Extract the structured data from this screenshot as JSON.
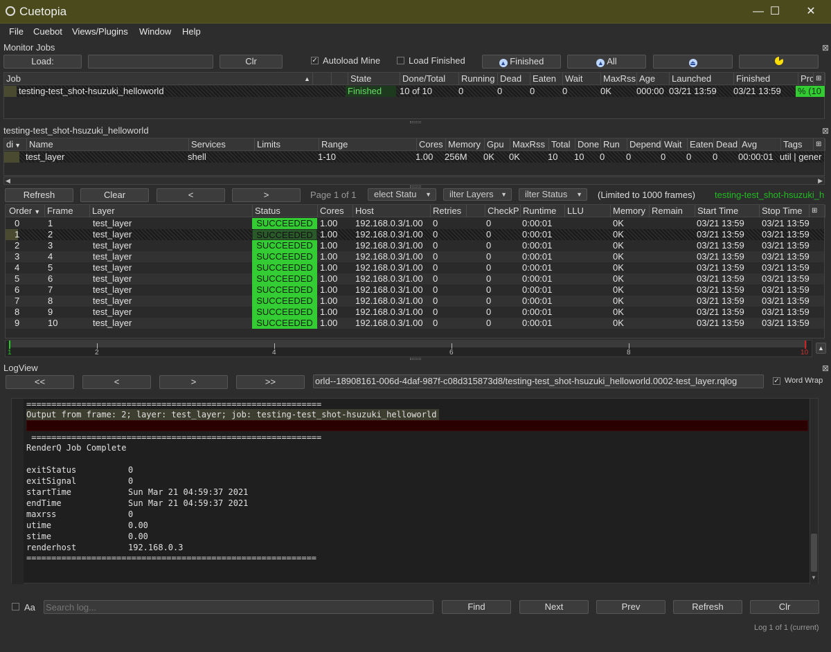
{
  "window": {
    "title": "Cuetopia",
    "minimize": "—",
    "maximize": "☐",
    "close": "✕"
  },
  "menu": [
    "File",
    "Cuebot",
    "Views/Plugins",
    "Window",
    "Help"
  ],
  "monitor_jobs": {
    "title": "Monitor Jobs",
    "load_label": "Load:",
    "load_value": "",
    "clr_label": "Clr",
    "autoload_label": "Autoload Mine",
    "autoload_checked": true,
    "load_finished_label": "Load Finished",
    "load_finished_checked": false,
    "finished_btn": "Finished",
    "all_btn": "All",
    "columns": [
      "Job",
      "",
      "State",
      "Done/Total",
      "Running",
      "Dead",
      "Eaten",
      "Wait",
      "MaxRss",
      "Age",
      "Launched",
      "Finished",
      "Pro"
    ],
    "rows": [
      {
        "job": "testing-test_shot-hsuzuki_helloworld",
        "state": "Finished",
        "done_total": "10 of 10",
        "running": "0",
        "dead": "0",
        "eaten": "0",
        "wait": "0",
        "maxrss": "0K",
        "age": "000:00",
        "launched": "03/21 13:59",
        "finished": "03/21 13:59",
        "progress": "% (10"
      }
    ]
  },
  "layers": {
    "title": "testing-test_shot-hsuzuki_helloworld",
    "columns": [
      "di",
      "Name",
      "Services",
      "Limits",
      "Range",
      "Cores",
      "Memory",
      "Gpu",
      "MaxRss",
      "Total",
      "Done",
      "Run",
      "Depend",
      "Wait",
      "Eaten",
      "Dead",
      "Avg",
      "Tags"
    ],
    "rows": [
      {
        "name": "test_layer",
        "services": "shell",
        "limits": "",
        "range": "1-10",
        "cores": "1.00",
        "memory": "256M",
        "gpu": "0K",
        "maxrss": "0K",
        "total": "10",
        "done": "10",
        "run": "0",
        "depend": "0",
        "wait": "0",
        "eaten": "0",
        "dead": "0",
        "avg": "00:00:01",
        "tags": "util | gener"
      }
    ]
  },
  "frames": {
    "refresh": "Refresh",
    "clear": "Clear",
    "prev": "<",
    "next": ">",
    "page": "Page 1 of 1",
    "select_status": "elect Statu",
    "filter_layers": "ilter Layers",
    "filter_status": "ilter Status",
    "limited": "(Limited to 1000 frames)",
    "job_name": "testing-test_shot-hsuzuki_h",
    "columns": [
      "Order",
      "Frame",
      "Layer",
      "Status",
      "Cores",
      "Host",
      "Retries",
      "",
      "CheckP",
      "Runtime",
      "LLU",
      "Memory",
      "Remain",
      "Start Time",
      "Stop Time"
    ],
    "rows": [
      {
        "order": "0",
        "frame": "1",
        "layer": "test_layer",
        "status": "SUCCEEDED",
        "cores": "1.00",
        "host": "192.168.0.3/1.00",
        "retries": "0",
        "checkp": "0",
        "runtime": "0:00:01",
        "llu": "",
        "memory": "0K",
        "remain": "",
        "start": "03/21 13:59",
        "stop": "03/21 13:59"
      },
      {
        "order": "1",
        "frame": "2",
        "layer": "test_layer",
        "status": "SUCCEEDED",
        "cores": "1.00",
        "host": "192.168.0.3/1.00",
        "retries": "0",
        "checkp": "0",
        "runtime": "0:00:01",
        "llu": "",
        "memory": "0K",
        "remain": "",
        "start": "03/21 13:59",
        "stop": "03/21 13:59"
      },
      {
        "order": "2",
        "frame": "3",
        "layer": "test_layer",
        "status": "SUCCEEDED",
        "cores": "1.00",
        "host": "192.168.0.3/1.00",
        "retries": "0",
        "checkp": "0",
        "runtime": "0:00:01",
        "llu": "",
        "memory": "0K",
        "remain": "",
        "start": "03/21 13:59",
        "stop": "03/21 13:59"
      },
      {
        "order": "3",
        "frame": "4",
        "layer": "test_layer",
        "status": "SUCCEEDED",
        "cores": "1.00",
        "host": "192.168.0.3/1.00",
        "retries": "0",
        "checkp": "0",
        "runtime": "0:00:01",
        "llu": "",
        "memory": "0K",
        "remain": "",
        "start": "03/21 13:59",
        "stop": "03/21 13:59"
      },
      {
        "order": "4",
        "frame": "5",
        "layer": "test_layer",
        "status": "SUCCEEDED",
        "cores": "1.00",
        "host": "192.168.0.3/1.00",
        "retries": "0",
        "checkp": "0",
        "runtime": "0:00:01",
        "llu": "",
        "memory": "0K",
        "remain": "",
        "start": "03/21 13:59",
        "stop": "03/21 13:59"
      },
      {
        "order": "5",
        "frame": "6",
        "layer": "test_layer",
        "status": "SUCCEEDED",
        "cores": "1.00",
        "host": "192.168.0.3/1.00",
        "retries": "0",
        "checkp": "0",
        "runtime": "0:00:01",
        "llu": "",
        "memory": "0K",
        "remain": "",
        "start": "03/21 13:59",
        "stop": "03/21 13:59"
      },
      {
        "order": "6",
        "frame": "7",
        "layer": "test_layer",
        "status": "SUCCEEDED",
        "cores": "1.00",
        "host": "192.168.0.3/1.00",
        "retries": "0",
        "checkp": "0",
        "runtime": "0:00:01",
        "llu": "",
        "memory": "0K",
        "remain": "",
        "start": "03/21 13:59",
        "stop": "03/21 13:59"
      },
      {
        "order": "7",
        "frame": "8",
        "layer": "test_layer",
        "status": "SUCCEEDED",
        "cores": "1.00",
        "host": "192.168.0.3/1.00",
        "retries": "0",
        "checkp": "0",
        "runtime": "0:00:01",
        "llu": "",
        "memory": "0K",
        "remain": "",
        "start": "03/21 13:59",
        "stop": "03/21 13:59"
      },
      {
        "order": "8",
        "frame": "9",
        "layer": "test_layer",
        "status": "SUCCEEDED",
        "cores": "1.00",
        "host": "192.168.0.3/1.00",
        "retries": "0",
        "checkp": "0",
        "runtime": "0:00:01",
        "llu": "",
        "memory": "0K",
        "remain": "",
        "start": "03/21 13:59",
        "stop": "03/21 13:59"
      },
      {
        "order": "9",
        "frame": "10",
        "layer": "test_layer",
        "status": "SUCCEEDED",
        "cores": "1.00",
        "host": "192.168.0.3/1.00",
        "retries": "0",
        "checkp": "0",
        "runtime": "0:00:01",
        "llu": "",
        "memory": "0K",
        "remain": "",
        "start": "03/21 13:59",
        "stop": "03/21 13:59"
      }
    ],
    "timeline_labels": [
      "1",
      "2",
      "4",
      "6",
      "8",
      "10"
    ]
  },
  "logview": {
    "title": "LogView",
    "first": "<<",
    "prev": "<",
    "next": ">",
    "last": ">>",
    "path": "orld--18908161-006d-4daf-987f-c08d315873d8/testing-test_shot-hsuzuki_helloworld.0002-test_layer.rqlog",
    "word_wrap_label": "Word Wrap",
    "word_wrap_checked": true,
    "separator": "===========================================================",
    "header_line": "Output from frame: 2; layer: test_layer; job: testing-test_shot-hsuzuki_helloworld",
    "separator2": " ==========================================================",
    "complete": "RenderQ Job Complete",
    "fields": [
      {
        "key": "exitStatus",
        "value": "0"
      },
      {
        "key": "exitSignal",
        "value": "0"
      },
      {
        "key": "startTime",
        "value": "Sun Mar 21 04:59:37 2021"
      },
      {
        "key": "endTime",
        "value": "Sun Mar 21 04:59:37 2021"
      },
      {
        "key": "maxrss",
        "value": "0"
      },
      {
        "key": "utime",
        "value": "0.00"
      },
      {
        "key": "stime",
        "value": "0.00"
      },
      {
        "key": "renderhost",
        "value": "192.168.0.3"
      }
    ],
    "separator3": "==========================================================",
    "case_label": "Aa",
    "search_placeholder": "Search log...",
    "find": "Find",
    "next_btn": "Next",
    "prev_btn": "Prev",
    "refresh": "Refresh",
    "clr": "Clr",
    "log_count": "Log 1 of 1 (current)"
  },
  "colors": {
    "accent": "#33cc33",
    "titlebar": "#4a4a1c",
    "error_band": "#2a0000"
  }
}
